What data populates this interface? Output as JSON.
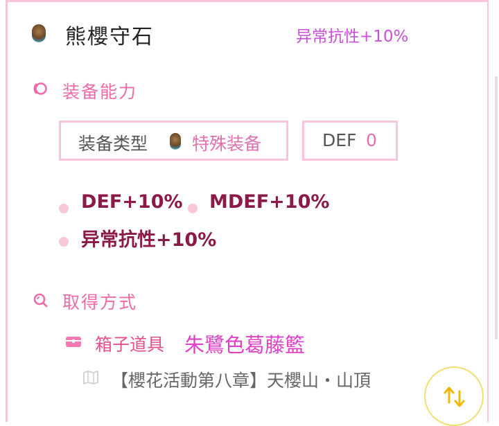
{
  "item": {
    "name": "熊櫻守石",
    "effect": "异常抗性+10%"
  },
  "equip_section": {
    "title": "装备能力",
    "type_label": "装备类型",
    "type_value": "特殊装备",
    "def_label": "DEF",
    "def_value": "0",
    "bonuses": [
      "DEF+10%",
      "MDEF+10%",
      "异常抗性+10%"
    ]
  },
  "acquire_section": {
    "title": "取得方式",
    "source_type": "箱子道具",
    "source_name": "朱鷺色葛藤籃",
    "location": "【櫻花活動第八章】天櫻山・山頂"
  },
  "colors": {
    "accent_pink": "#f06aa8",
    "border_pink": "#f7c6dc",
    "bonus_text": "#8a1a48",
    "effect_purple": "#c84fd8"
  },
  "icons": {
    "item": "gem-stone-icon",
    "equip": "ring-icon",
    "acquire": "search-icon",
    "source": "chest-icon",
    "location": "map-icon",
    "swap": "swap-arrows-icon"
  }
}
